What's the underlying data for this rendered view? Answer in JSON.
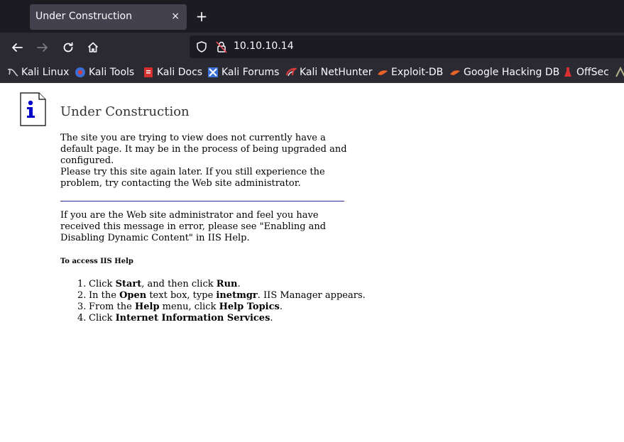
{
  "browser": {
    "tab": {
      "title": "Under Construction",
      "close_glyph": "×"
    },
    "new_tab_glyph": "+",
    "url": "10.10.10.14",
    "bookmarks": [
      {
        "label": "Kali Linux",
        "icon": "kali-dragon-icon"
      },
      {
        "label": "Kali Tools",
        "icon": "kali-tools-icon"
      },
      {
        "label": "Kali Docs",
        "icon": "kali-docs-icon"
      },
      {
        "label": "Kali Forums",
        "icon": "kali-forums-icon"
      },
      {
        "label": "Kali NetHunter",
        "icon": "nethunter-icon"
      },
      {
        "label": "Exploit-DB",
        "icon": "exploit-db-icon"
      },
      {
        "label": "Google Hacking DB",
        "icon": "ghdb-icon"
      },
      {
        "label": "OffSec",
        "icon": "offsec-icon"
      }
    ]
  },
  "page": {
    "heading": "Under Construction",
    "para1": "The site you are trying to view does not currently have a default page. It may be in the process of being upgraded and configured.",
    "para2": "Please try this site again later. If you still experience the problem, try contacting the Web site administrator.",
    "para3": "If you are the Web site administrator and feel you have received this message in error, please see \"Enabling and Disabling Dynamic Content\" in IIS Help.",
    "help_heading": "To access IIS Help",
    "steps": {
      "s1": {
        "num": "1.",
        "a": "Click ",
        "b": "Start",
        "c": ", and then click ",
        "d": "Run",
        "e": "."
      },
      "s2": {
        "num": "2.",
        "a": "In the ",
        "b": "Open",
        "c": " text box, type ",
        "d": "inetmgr",
        "e": ". IIS Manager appears."
      },
      "s3": {
        "num": "3.",
        "a": "From the ",
        "b": "Help",
        "c": " menu, click ",
        "d": "Help Topics",
        "e": "."
      },
      "s4": {
        "num": "4.",
        "a": "Click ",
        "b": "Internet Information Services",
        "c": ".",
        "d": "",
        "e": ""
      }
    }
  },
  "colors": {
    "chrome_dark": "#1c1b22",
    "chrome_mid": "#2b2a33",
    "tab_active": "#42414d",
    "rule": "#2a2a9a"
  }
}
